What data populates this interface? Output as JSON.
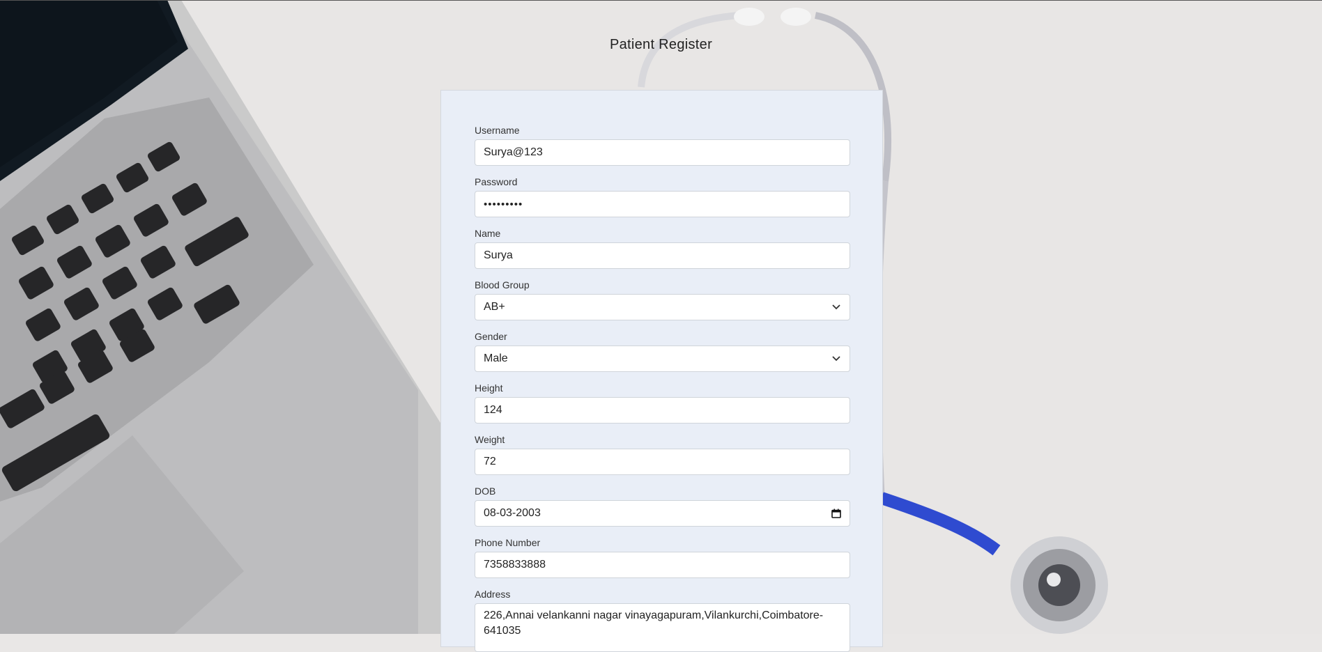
{
  "page": {
    "title": "Patient Register"
  },
  "form": {
    "username": {
      "label": "Username",
      "value": "Surya@123"
    },
    "password": {
      "label": "Password",
      "value": "•••••••••"
    },
    "name": {
      "label": "Name",
      "value": "Surya"
    },
    "blood_group": {
      "label": "Blood Group",
      "value": "AB+"
    },
    "gender": {
      "label": "Gender",
      "value": "Male"
    },
    "height": {
      "label": "Height",
      "value": "124"
    },
    "weight": {
      "label": "Weight",
      "value": "72"
    },
    "dob": {
      "label": "DOB",
      "value": "08-03-2003"
    },
    "phone": {
      "label": "Phone Number",
      "value": "7358833888"
    },
    "address": {
      "label": "Address",
      "value": "226,Annai velankanni nagar vinayagapuram,Vilankurchi,Coimbatore-641035"
    }
  },
  "colors": {
    "card_bg": "#e9eef7",
    "stethoscope_tube": "#2f4bd0",
    "laptop_body": "#c9c9cb",
    "keys": "#2a2a2c"
  },
  "icons": [
    "chevron-down-icon",
    "calendar-icon"
  ]
}
